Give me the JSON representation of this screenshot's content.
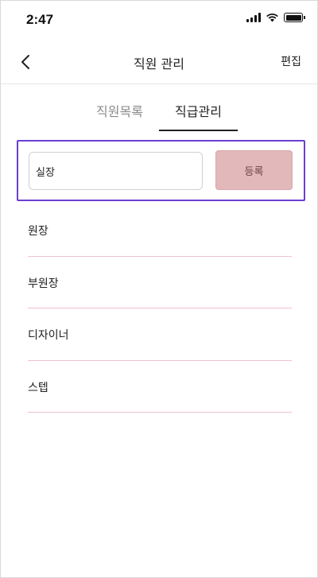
{
  "status_bar": {
    "time": "2:47"
  },
  "header": {
    "title": "직원 관리",
    "edit_label": "편집"
  },
  "tabs": [
    {
      "label": "직원목록",
      "active": false
    },
    {
      "label": "직급관리",
      "active": true
    }
  ],
  "form": {
    "input_value": "실장",
    "register_label": "등록"
  },
  "positions": [
    "원장",
    "부원장",
    "디자이너",
    "스텝"
  ],
  "colors": {
    "accent_border": "#6a3fd0",
    "register_button": "#e2b8bb",
    "divider": "#f0c2cc"
  },
  "icons": {
    "back": "chevron-left-icon",
    "signal": "signal-icon",
    "wifi": "wifi-icon",
    "battery": "battery-icon"
  }
}
